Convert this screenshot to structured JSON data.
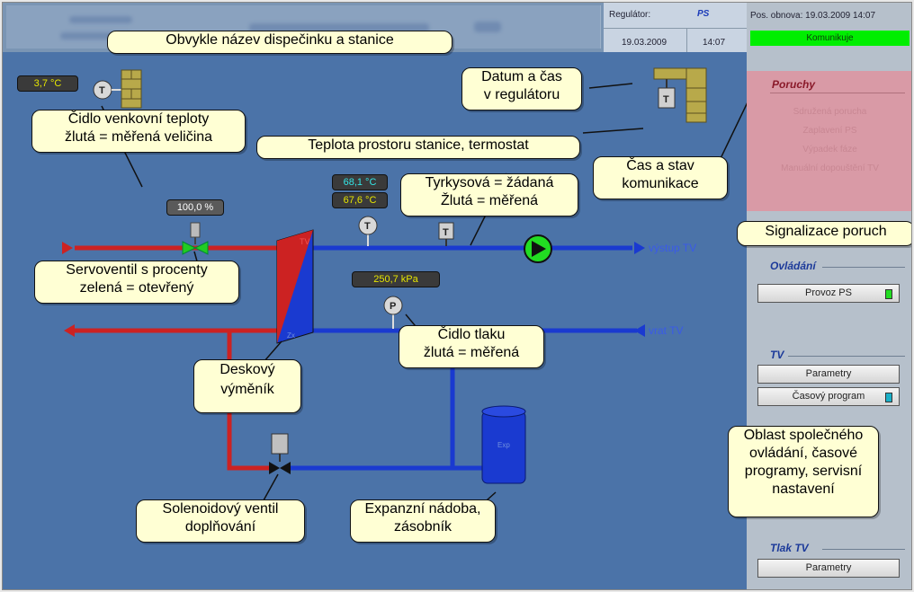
{
  "header": {
    "regulator_label": "Regulátor:",
    "regulator_value": "PS",
    "date": "19.03.2009",
    "time": "14:07"
  },
  "status": {
    "last_update": "Pos. obnova: 19.03.2009 14:07",
    "communication": "Komunikuje"
  },
  "faults": {
    "title": "Poruchy",
    "items": [
      "Sdružená porucha",
      "Zaplavení PS",
      "Výpadek fáze",
      "Manuální dopouštění TV"
    ]
  },
  "control": {
    "title": "Ovládání",
    "buttons": [
      "Provoz PS"
    ]
  },
  "tv": {
    "title": "TV",
    "buttons": [
      "Parametry",
      "Časový program"
    ]
  },
  "pressure_tv": {
    "title": "Tlak TV",
    "buttons": [
      "Parametry"
    ]
  },
  "values": {
    "outdoor_temp": "3,7 °C",
    "valve_percent": "100,0 %",
    "setpoint_temp": "68,1 °C",
    "measured_temp": "67,6 °C",
    "pressure": "250,7 kPa"
  },
  "labels": {
    "output_tv": "výstup TV",
    "return_tv": "vrat TV",
    "exchanger_tag": "TV",
    "exchanger_tag2": "Zx",
    "vessel_tag": "Exp"
  },
  "callouts": {
    "header": "Obvykle název dispečinku a stanice",
    "datetime": "Datum a čas\nv regulátoru",
    "outdoor": "Čidlo venkovní teploty\nžlutá = měřená veličina",
    "room": "Teplota prostoru stanice, termostat",
    "setpoint": "Tyrkysová = žádaná\nŽlutá = měřená",
    "comm": "Čas a stav\nkomunikace",
    "faults": "Signalizace poruch",
    "valve": "Servoventil s procenty\nzelená = otevřený",
    "pressure": "Čidlo tlaku\nžlutá = měřená",
    "exchanger": "Deskový\nvýměník",
    "common": "Oblast společného\novládání, časové\nprogramy, servisní\nnastavení",
    "solenoid": "Solenoidový ventil\ndoplňování",
    "vessel": "Expanzní nádoba,\nzásobník"
  },
  "colors": {
    "background": "#4b73a8",
    "hot_pipe": "#cc2222",
    "cold_pipe": "#1a3ad0",
    "communication_ok": "#00ee00",
    "measured": "#e6e600",
    "setpoint": "#33e6e6"
  }
}
